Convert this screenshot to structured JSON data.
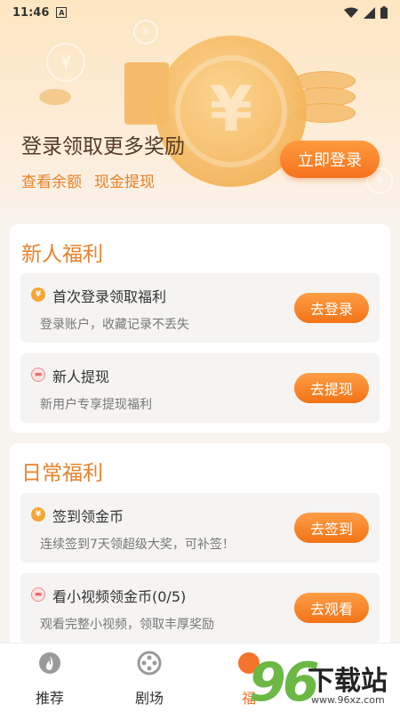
{
  "status_bar": {
    "time": "11:46",
    "notification_letter": "A"
  },
  "hero": {
    "title": "登录领取更多奖励",
    "links": [
      "查看余额",
      "现金提现"
    ],
    "login_button": "立即登录"
  },
  "sections": [
    {
      "title": "新人福利",
      "items": [
        {
          "icon": "coin-icon",
          "title": "首次登录领取福利",
          "desc": "登录账户，收藏记录不丢失",
          "action": "去登录"
        },
        {
          "icon": "red-envelope-icon",
          "title": "新人提现",
          "desc": "新用户专享提现福利",
          "action": "去提现"
        }
      ]
    },
    {
      "title": "日常福利",
      "items": [
        {
          "icon": "coin-icon",
          "title": "签到领金币",
          "desc": "连续签到7天领超级大奖，可补签！",
          "action": "去签到"
        },
        {
          "icon": "red-envelope-icon",
          "title": "看小视频领金币(0/5)",
          "desc": "观看完整小视频，领取丰厚奖励",
          "action": "去观看"
        }
      ]
    }
  ],
  "tabbar": {
    "tabs": [
      {
        "label": "推荐",
        "icon": "flame-icon"
      },
      {
        "label": "剧场",
        "icon": "film-reel-icon"
      },
      {
        "label": "福",
        "icon": "welfare-icon"
      }
    ]
  },
  "watermark": {
    "number": "96",
    "text": "下载站",
    "url": "www.96xz.com"
  },
  "colors": {
    "accent": "#f5732a",
    "section_title": "#e8822a",
    "hero_bg": "#fde6c2"
  }
}
